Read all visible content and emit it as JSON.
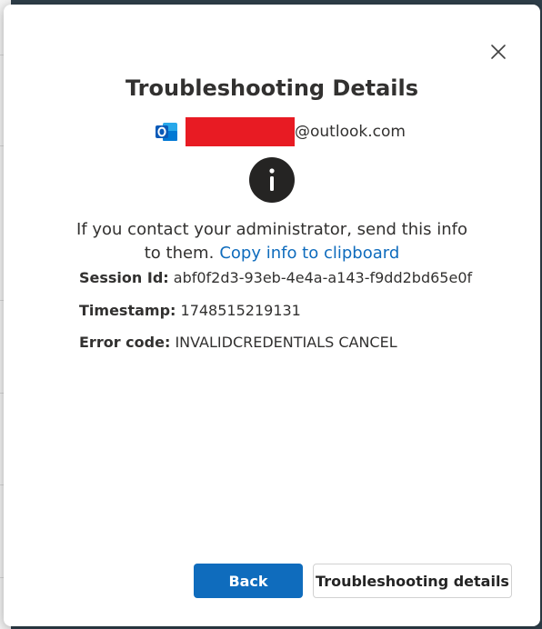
{
  "dialog": {
    "title": "Troubleshooting Details",
    "account_domain": "@outlook.com",
    "message_line1": "If you contact your administrator, send this info",
    "message_line2": "to them.",
    "copy_link": "Copy info to clipboard",
    "details": [
      {
        "key": "Session Id:",
        "value": "abf0f2d3-93eb-4e4a-a143-f9dd2bd65e0f"
      },
      {
        "key": "Timestamp:",
        "value": "1748515219131"
      },
      {
        "key": "Error code:",
        "value": "INVALIDCREDENTIALS CANCEL"
      }
    ],
    "back_label": "Back",
    "troubleshooting_label": "Troubleshooting details"
  },
  "colors": {
    "accent": "#0f6cbd",
    "redaction": "#e81b23",
    "info_circle": "#252423"
  },
  "icons": [
    "close-icon",
    "outlook-icon",
    "info-icon"
  ]
}
